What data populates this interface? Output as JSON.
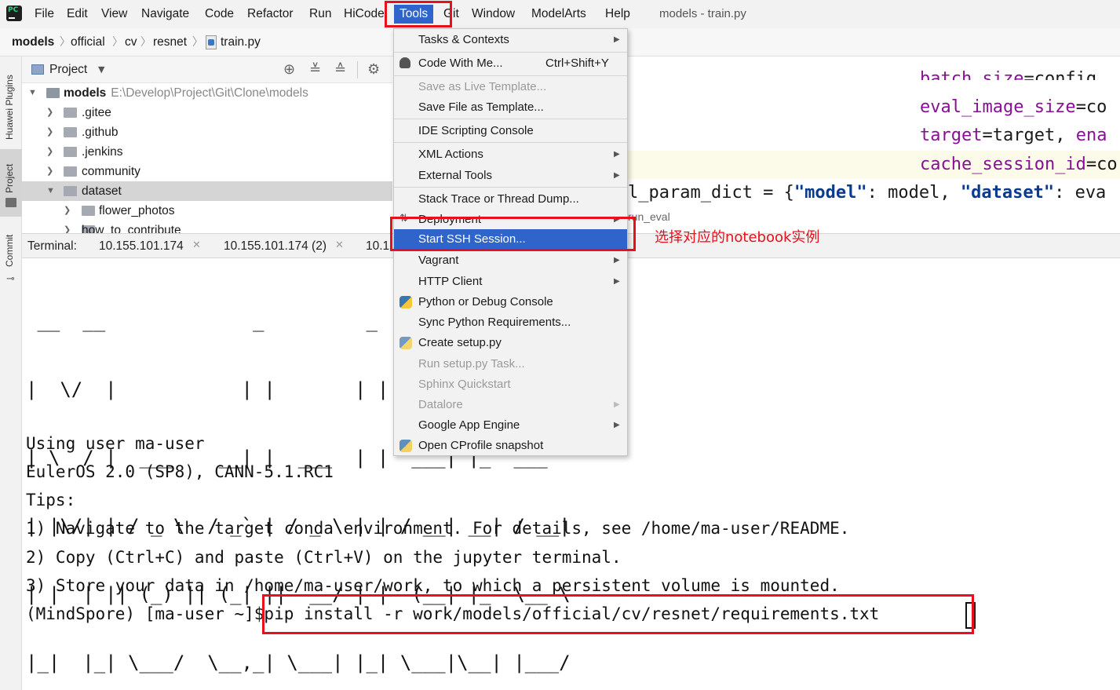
{
  "menubar": {
    "items": [
      "File",
      "Edit",
      "View",
      "Navigate",
      "Code",
      "Refactor",
      "Run",
      "HiCode",
      "Tools",
      "Git",
      "Window",
      "ModelArts",
      "Help"
    ],
    "window_title": "models - train.py"
  },
  "breadcrumb": [
    "models",
    "official",
    "cv",
    "resnet",
    "train.py"
  ],
  "left_strip": {
    "tabs": [
      "Huawei Plugins",
      "Project",
      "Commit"
    ]
  },
  "project_panel": {
    "title": "Project",
    "tree": [
      {
        "name": "models",
        "path": "E:\\Develop\\Project\\Git\\Clone\\models",
        "expanded": true
      },
      {
        "name": ".gitee"
      },
      {
        "name": ".github"
      },
      {
        "name": ".jenkins"
      },
      {
        "name": "community"
      },
      {
        "name": "dataset",
        "expanded": true
      },
      {
        "name": "flower_photos"
      },
      {
        "name": "how_to_contribute"
      }
    ]
  },
  "editor": {
    "lines": [
      {
        "param": "batch_size",
        "rest": "=config."
      },
      {
        "param": "eval_image_size",
        "rest": "=co"
      },
      {
        "param": "target",
        "rest": "=target, ",
        "param2": "ena"
      },
      {
        "param": "cache_session_id",
        "rest": "=co"
      }
    ],
    "dict_line": {
      "prefix": "l_param_dict = {",
      "key1": "\"model\"",
      "mid": ": model, ",
      "key2": "\"dataset\"",
      "suffix": ": eva"
    },
    "run_tab": "run_eval"
  },
  "terminal": {
    "label": "Terminal:",
    "tabs": [
      "10.155.101.174",
      "10.155.101.174 (2)",
      "10.1"
    ],
    "banner": [
      " __  __             _         _       _",
      "|  \\/  |           | |       | |     | |",
      "| \\  / |  ___    __| |  ___  | |  ___| |_  ___",
      "| |\\/| | / _ \\  / _` | / _ \\ | | / __| __| / __|",
      "| |  | || (_) || (_| ||  __/ | |  (__| |_  \\__ \\",
      "|_|  |_| \\___/  \\__,_| \\___| |_| \\___|\\__| |___/"
    ],
    "lines": [
      "Using user ma-user",
      "EulerOS 2.0 (SP8), CANN-5.1.RC1",
      "Tips:",
      "1) Navigate to the target conda environment. For details, see /home/ma-user/README.",
      "2) Copy (Ctrl+C) and paste (Ctrl+V) on the jupyter terminal.",
      "3) Store your data in /home/ma-user/work, to which a persistent volume is mounted.",
      "(MindSpore) [ma-user ~]$pip install -r work/models/official/cv/resnet/requirements.txt"
    ]
  },
  "tools_menu": {
    "items": [
      {
        "label": "Tasks & Contexts",
        "submenu": true
      },
      {
        "label": "Code With Me...",
        "shortcut": "Ctrl+Shift+Y",
        "icon": "person-icon"
      },
      {
        "label": "Save as Live Template...",
        "disabled": true
      },
      {
        "label": "Save File as Template..."
      },
      {
        "label": "IDE Scripting Console"
      },
      {
        "label": "XML Actions",
        "submenu": true
      },
      {
        "label": "External Tools",
        "submenu": true
      },
      {
        "label": "Stack Trace or Thread Dump..."
      },
      {
        "label": "Deployment",
        "submenu": true,
        "icon": "deployment-icon"
      },
      {
        "label": "Start SSH Session...",
        "selected": true
      },
      {
        "label": "Vagrant",
        "submenu": true
      },
      {
        "label": "HTTP Client",
        "submenu": true
      },
      {
        "label": "Python or Debug Console",
        "icon": "python-icon"
      },
      {
        "label": "Sync Python Requirements..."
      },
      {
        "label": "Create setup.py",
        "icon": "setup-py-icon"
      },
      {
        "label": "Run setup.py Task...",
        "disabled": true
      },
      {
        "label": "Sphinx Quickstart",
        "disabled": true
      },
      {
        "label": "Datalore",
        "disabled": true,
        "submenu": true
      },
      {
        "label": "Google App Engine",
        "submenu": true
      },
      {
        "label": "Open CProfile snapshot",
        "icon": "cprofile-icon"
      }
    ]
  },
  "annotation": "选择对应的notebook实例",
  "colors": {
    "highlight_red": "#e8101a",
    "selection_blue": "#2f65ca"
  }
}
